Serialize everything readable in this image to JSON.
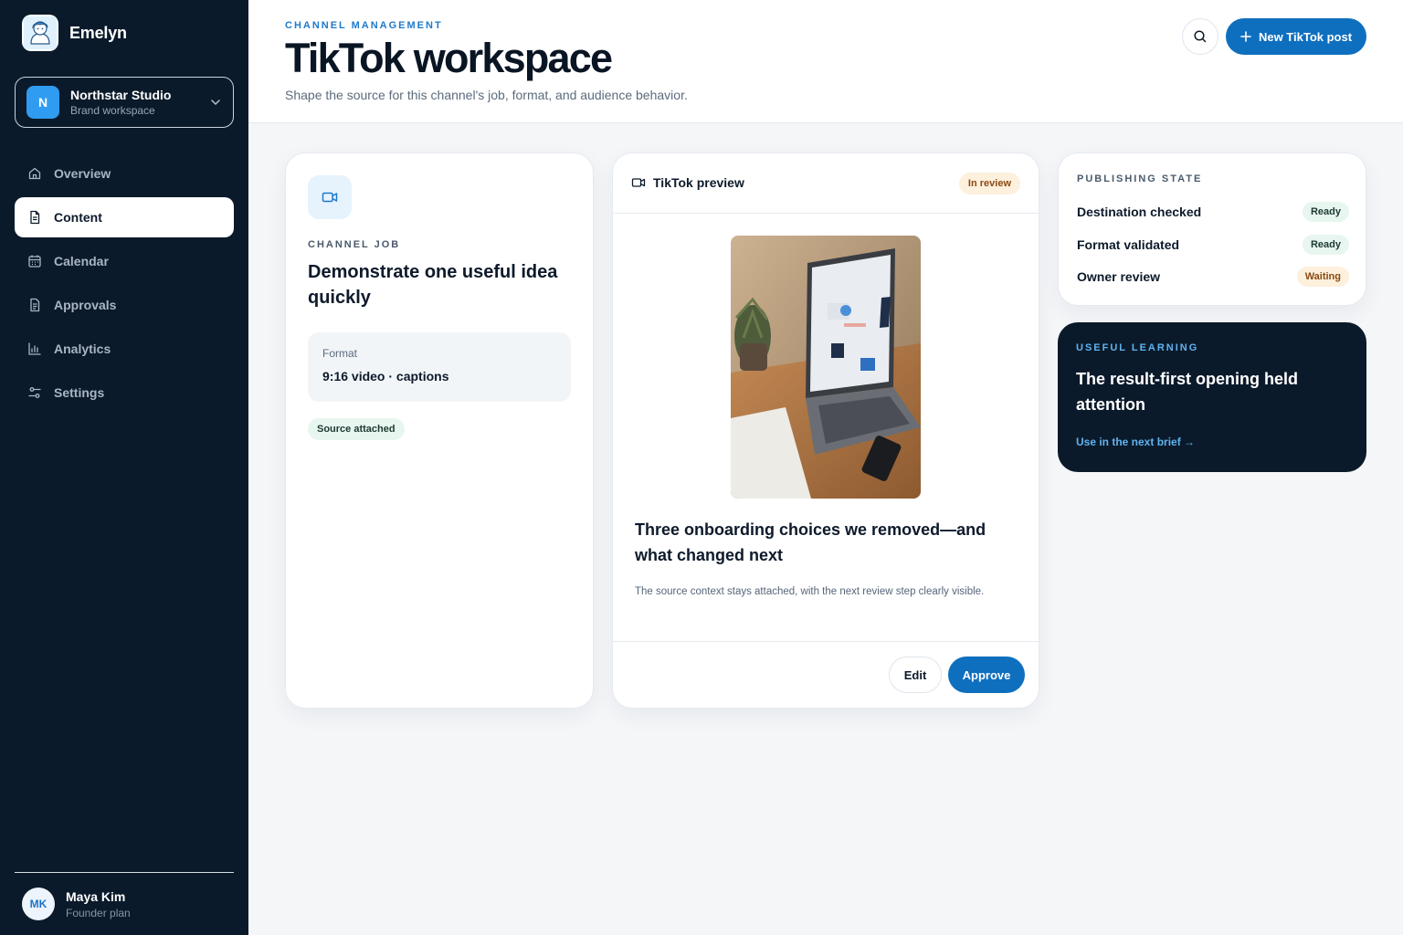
{
  "sidebar": {
    "brand": "Emelyn",
    "workspace": {
      "initial": "N",
      "name": "Northstar Studio",
      "subtitle": "Brand workspace"
    },
    "nav": [
      {
        "label": "Overview",
        "icon": "home-icon"
      },
      {
        "label": "Content",
        "icon": "document-icon",
        "active": true
      },
      {
        "label": "Calendar",
        "icon": "calendar-icon"
      },
      {
        "label": "Approvals",
        "icon": "clipboard-icon"
      },
      {
        "label": "Analytics",
        "icon": "bar-chart-icon"
      },
      {
        "label": "Settings",
        "icon": "sliders-icon"
      }
    ],
    "user": {
      "initials": "MK",
      "name": "Maya Kim",
      "plan": "Founder plan"
    }
  },
  "header": {
    "eyebrow": "CHANNEL MANAGEMENT",
    "title": "TikTok workspace",
    "subtitle": "Shape the source for this channel's job, format, and audience behavior.",
    "new_button": "New TikTok post"
  },
  "job": {
    "label": "CHANNEL JOB",
    "title": "Demonstrate one useful idea quickly",
    "format_label": "Format",
    "format_value": "9:16 video · captions",
    "badge": "Source attached"
  },
  "preview": {
    "title": "TikTok preview",
    "status": "In review",
    "post_title": "Three onboarding choices we removed—and what changed next",
    "description": "The source context stays attached, with the next review step clearly visible.",
    "edit_label": "Edit",
    "approve_label": "Approve"
  },
  "publishing": {
    "label": "PUBLISHING STATE",
    "rows": [
      {
        "name": "Destination checked",
        "status": "Ready"
      },
      {
        "name": "Format validated",
        "status": "Ready"
      },
      {
        "name": "Owner review",
        "status": "Waiting"
      }
    ]
  },
  "learning": {
    "label": "USEFUL LEARNING",
    "title": "The result-first opening held attention",
    "link": "Use in the next brief →"
  },
  "colors": {
    "sidebar_bg": "#0b1a2a",
    "accent": "#0f6fbf",
    "ready_bg": "#e8f6f0",
    "waiting_bg": "#fdf0dd"
  }
}
